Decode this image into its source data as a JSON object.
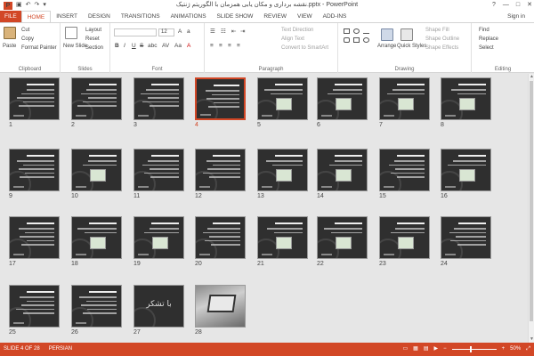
{
  "window": {
    "title": "نقشه برداری و مکان یابی همزمان با الگوریتم ژنتیک.pptx - PowerPoint",
    "app_badge": "P",
    "signin": "Sign in",
    "controls": [
      "?",
      "—",
      "□",
      "✕"
    ]
  },
  "qat": [
    "↶",
    "↷",
    "▣",
    "▾"
  ],
  "tabs": [
    "FILE",
    "HOME",
    "INSERT",
    "DESIGN",
    "TRANSITIONS",
    "ANIMATIONS",
    "SLIDE SHOW",
    "REVIEW",
    "VIEW",
    "ADD-INS"
  ],
  "active_tab": "HOME",
  "ribbon": {
    "clipboard": {
      "label": "Clipboard",
      "paste": "Paste",
      "cut": "Cut",
      "copy": "Copy",
      "format_painter": "Format Painter"
    },
    "slides": {
      "label": "Slides",
      "new_slide": "New Slide",
      "layout": "Layout",
      "reset": "Reset",
      "section": "Section"
    },
    "font": {
      "label": "Font",
      "font_size": "12",
      "bold": "B",
      "italic": "I",
      "underline": "U",
      "strike": "S",
      "shadow": "abc",
      "spacing": "AV",
      "case": "Aa",
      "color": "A"
    },
    "paragraph": {
      "label": "Paragraph",
      "text_direction": "Text Direction",
      "align_text": "Align Text",
      "convert_smartart": "Convert to SmartArt"
    },
    "drawing": {
      "label": "Drawing",
      "arrange": "Arrange",
      "quick_styles": "Quick Styles",
      "shape_fill": "Shape Fill",
      "shape_outline": "Shape Outline",
      "shape_effects": "Shape Effects"
    },
    "editing": {
      "label": "Editing",
      "find": "Find",
      "replace": "Replace",
      "select": "Select"
    }
  },
  "slides": [
    {
      "num": "1",
      "kind": "title"
    },
    {
      "num": "2",
      "kind": "text"
    },
    {
      "num": "3",
      "kind": "text"
    },
    {
      "num": "4",
      "kind": "text",
      "selected": true
    },
    {
      "num": "5",
      "kind": "figure"
    },
    {
      "num": "6",
      "kind": "figure"
    },
    {
      "num": "7",
      "kind": "figure"
    },
    {
      "num": "8",
      "kind": "figure"
    },
    {
      "num": "9",
      "kind": "text"
    },
    {
      "num": "10",
      "kind": "figure"
    },
    {
      "num": "11",
      "kind": "text"
    },
    {
      "num": "12",
      "kind": "text"
    },
    {
      "num": "13",
      "kind": "figure"
    },
    {
      "num": "14",
      "kind": "figure"
    },
    {
      "num": "15",
      "kind": "text"
    },
    {
      "num": "16",
      "kind": "figure"
    },
    {
      "num": "17",
      "kind": "text"
    },
    {
      "num": "18",
      "kind": "figure"
    },
    {
      "num": "19",
      "kind": "figure"
    },
    {
      "num": "20",
      "kind": "text"
    },
    {
      "num": "21",
      "kind": "figure"
    },
    {
      "num": "22",
      "kind": "figure"
    },
    {
      "num": "23",
      "kind": "figure"
    },
    {
      "num": "24",
      "kind": "text"
    },
    {
      "num": "25",
      "kind": "text"
    },
    {
      "num": "26",
      "kind": "text"
    },
    {
      "num": "27",
      "kind": "thanks",
      "big_text": "با تشکر"
    },
    {
      "num": "28",
      "kind": "photo"
    }
  ],
  "status": {
    "slide_info": "SLIDE 4 OF 28",
    "language": "PERSIAN",
    "zoom": "50%",
    "zoom_minus": "−",
    "zoom_plus": "+"
  },
  "colors": {
    "accent": "#d24726",
    "selected_border": "#d24726"
  }
}
